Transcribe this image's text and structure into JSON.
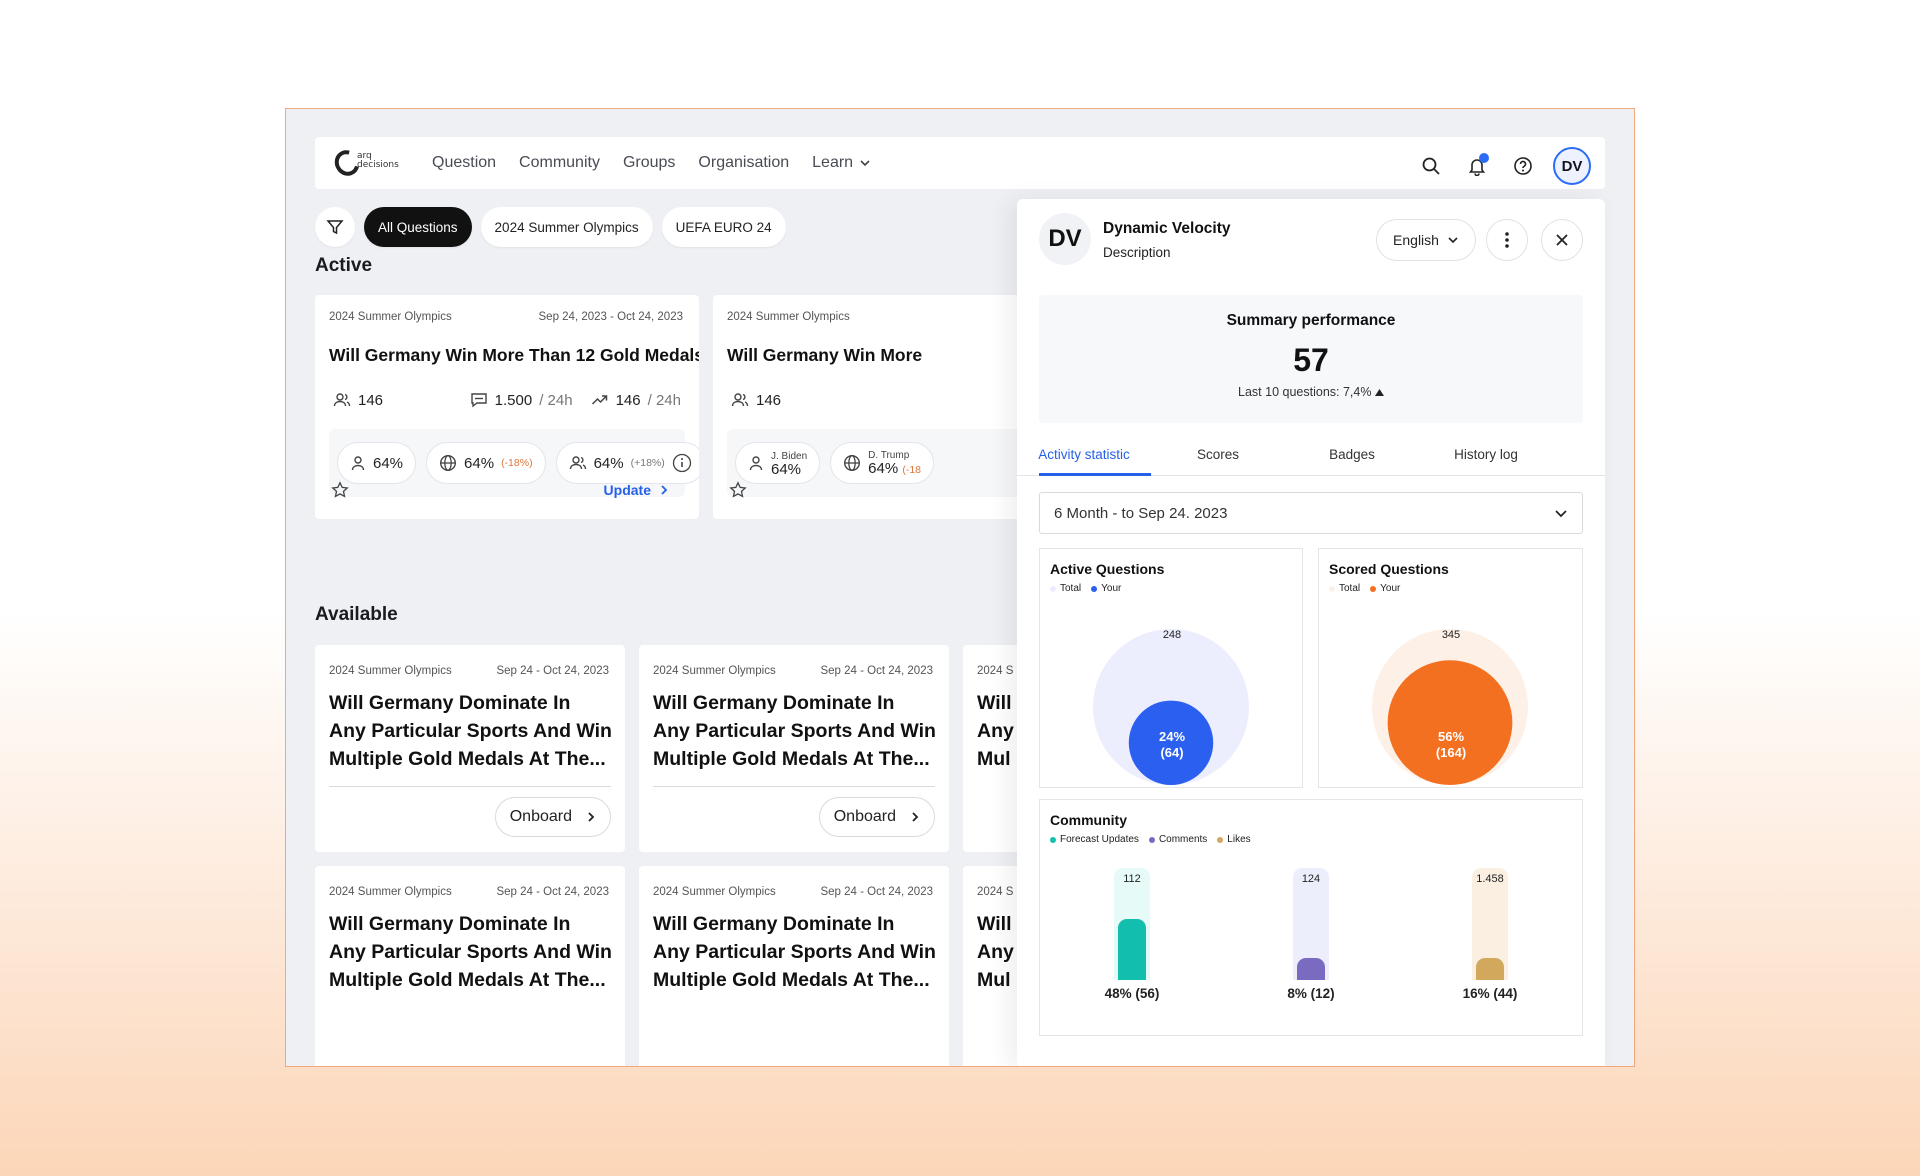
{
  "nav": {
    "logo_text_1": "arq",
    "logo_text_2": "decisions",
    "links": [
      "Question",
      "Community",
      "Groups",
      "Organisation",
      "Learn"
    ],
    "avatar": "DV",
    "icons": [
      "search-icon",
      "bell-icon",
      "help-icon"
    ]
  },
  "filters": [
    "All Questions",
    "2024 Summer Olympics",
    "UEFA EURO 24"
  ],
  "sections": {
    "active": "Active",
    "available": "Available"
  },
  "active_cards": [
    {
      "category": "2024 Summer Olympics",
      "dates": "Sep 24, 2023 - Oct 24, 2023",
      "title": "Will Germany Win More Than 12 Gold Medals ?",
      "participants": "146",
      "comments": "1.500",
      "comments_unit": "/ 24h",
      "trend": "146",
      "trend_unit": "/ 24h",
      "pill_1": "64%",
      "pill_2": "64%",
      "pill_2_change": "(-18%)",
      "pill_3": "64%",
      "pill_3_change": "(+18%)",
      "update_label": "Update"
    },
    {
      "category": "2024 Summer Olympics",
      "title": "Will Germany Win More",
      "participants": "146",
      "pill_1_name": "J. Biden",
      "pill_1": "64%",
      "pill_2_name": "D. Trump",
      "pill_2": "64%",
      "pill_2_change": "(-18"
    }
  ],
  "available_cards": [
    {
      "category": "2024 Summer Olympics",
      "dates": "Sep 24 - Oct 24, 2023",
      "line1": "Will Germany Dominate In",
      "line2": "Any Particular Sports And Win",
      "line3": "Multiple Gold Medals At The...",
      "button": "Onboard"
    },
    {
      "category": "2024 Summer Olympics",
      "dates": "Sep 24 - Oct 24, 2023",
      "line1": "Will Germany Dominate In",
      "line2": "Any Particular Sports And Win",
      "line3": "Multiple Gold Medals At The...",
      "button": "Onboard"
    },
    {
      "category": "2024 S",
      "line1": "Will",
      "line2": "Any",
      "line3": "Mul"
    },
    {
      "category": "2024 Summer Olympics",
      "dates": "Sep 24 - Oct 24, 2023",
      "line1": "Will Germany Dominate In",
      "line2": "Any Particular Sports And Win",
      "line3": "Multiple Gold Medals At The..."
    },
    {
      "category": "2024 Summer Olympics",
      "dates": "Sep 24 - Oct 24, 2023",
      "line1": "Will Germany Dominate In",
      "line2": "Any Particular Sports And Win",
      "line3": "Multiple Gold Medals At The..."
    },
    {
      "category": "2024 S",
      "line1": "Will",
      "line2": "Any",
      "line3": "Mul"
    }
  ],
  "panel": {
    "avatar": "DV",
    "name": "Dynamic Velocity",
    "description": "Description",
    "language": "English",
    "summary_title": "Summary performance",
    "summary_value": "57",
    "summary_sub": "Last 10 questions: 7,4%",
    "tabs": [
      "Activity statistic",
      "Scores",
      "Badges",
      "History log"
    ],
    "range": "6 Month - to Sep 24. 2023",
    "active_q": {
      "title": "Active Questions",
      "legend_total": "Total",
      "legend_your": "Your",
      "total": "248",
      "pct": "24%",
      "count": "(64)",
      "fraction": 0.24
    },
    "scored_q": {
      "title": "Scored Questions",
      "legend_total": "Total",
      "legend_your": "Your",
      "total": "345",
      "pct": "56%",
      "count": "(164)",
      "fraction": 0.56
    },
    "community": {
      "title": "Community",
      "legend": [
        "Forecast Updates",
        "Comments",
        "Likes"
      ],
      "colors": [
        "#12bfae",
        "#7b6bc0",
        "#d2a95c"
      ],
      "track_colors": [
        "#e6faf8",
        "#eceefb",
        "#fbefe2"
      ],
      "totals": [
        "112",
        "124",
        "1.458"
      ],
      "labels": [
        "48% (56)",
        "8% (12)",
        "16% (44)"
      ],
      "fractions": [
        0.48,
        0.08,
        0.16
      ]
    },
    "colors": {
      "active_your": "#2b5ff0",
      "active_total": "#eceefd",
      "scored_your": "#f37021",
      "scored_total": "#fdf0e6"
    }
  }
}
